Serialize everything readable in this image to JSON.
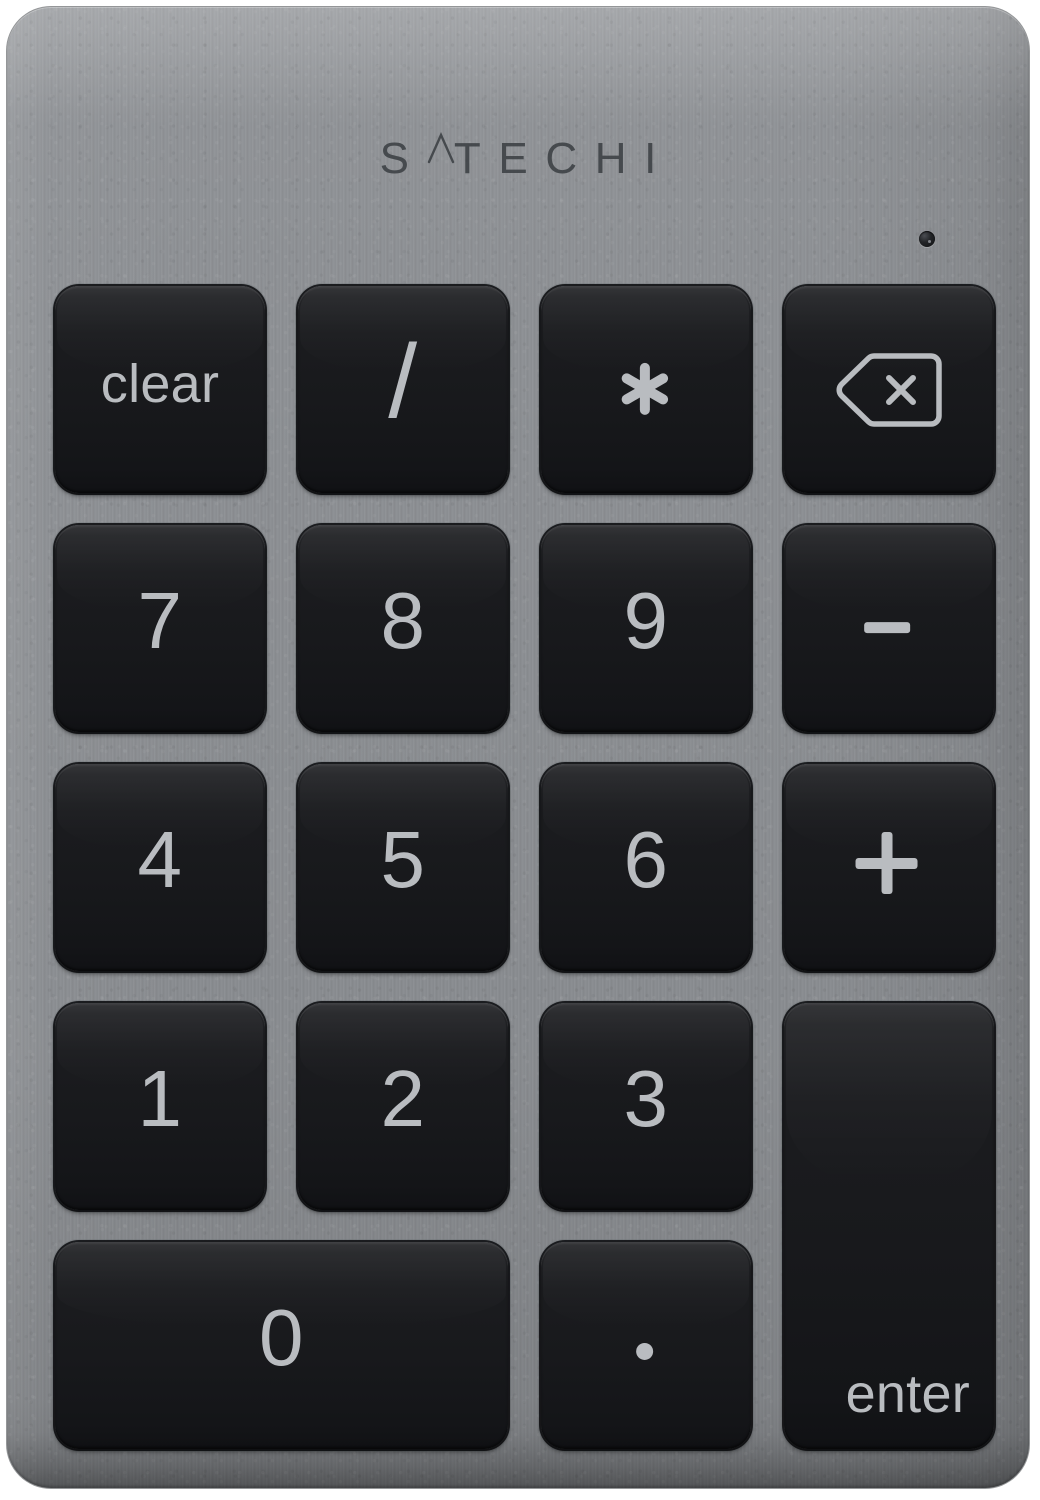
{
  "device": {
    "brand": "SATECHI",
    "brand_letters": [
      "S",
      "A",
      "T",
      "E",
      "C",
      "H",
      "I"
    ],
    "type": "wireless numeric keypad",
    "body_color": "#8d9094",
    "key_color": "#18191c",
    "legend_color": "#b9bcc0",
    "logo_color": "#3c4044"
  },
  "indicator": {
    "name": "led-indicator",
    "color": "#232528"
  },
  "keypad": {
    "columns": 4,
    "rows": 5,
    "keys": [
      {
        "id": "clear",
        "label": "clear",
        "glyph": "text",
        "row": 1,
        "col": 1,
        "rowspan": 1,
        "colspan": 1,
        "label_style": "lbl-word"
      },
      {
        "id": "divide",
        "label": "/",
        "glyph": "text",
        "row": 1,
        "col": 2,
        "rowspan": 1,
        "colspan": 1,
        "label_style": "lbl-slash"
      },
      {
        "id": "multiply",
        "label": "*",
        "glyph": "asterisk",
        "row": 1,
        "col": 3,
        "rowspan": 1,
        "colspan": 1,
        "label_style": ""
      },
      {
        "id": "delete",
        "label": "",
        "glyph": "delete",
        "row": 1,
        "col": 4,
        "rowspan": 1,
        "colspan": 1,
        "label_style": ""
      },
      {
        "id": "digit-7",
        "label": "7",
        "glyph": "text",
        "row": 2,
        "col": 1,
        "rowspan": 1,
        "colspan": 1,
        "label_style": "lbl-digit"
      },
      {
        "id": "digit-8",
        "label": "8",
        "glyph": "text",
        "row": 2,
        "col": 2,
        "rowspan": 1,
        "colspan": 1,
        "label_style": "lbl-digit"
      },
      {
        "id": "digit-9",
        "label": "9",
        "glyph": "text",
        "row": 2,
        "col": 3,
        "rowspan": 1,
        "colspan": 1,
        "label_style": "lbl-digit"
      },
      {
        "id": "minus",
        "label": "-",
        "glyph": "minus",
        "row": 2,
        "col": 4,
        "rowspan": 1,
        "colspan": 1,
        "label_style": ""
      },
      {
        "id": "digit-4",
        "label": "4",
        "glyph": "text",
        "row": 3,
        "col": 1,
        "rowspan": 1,
        "colspan": 1,
        "label_style": "lbl-digit"
      },
      {
        "id": "digit-5",
        "label": "5",
        "glyph": "text",
        "row": 3,
        "col": 2,
        "rowspan": 1,
        "colspan": 1,
        "label_style": "lbl-digit"
      },
      {
        "id": "digit-6",
        "label": "6",
        "glyph": "text",
        "row": 3,
        "col": 3,
        "rowspan": 1,
        "colspan": 1,
        "label_style": "lbl-digit"
      },
      {
        "id": "plus",
        "label": "+",
        "glyph": "plus",
        "row": 3,
        "col": 4,
        "rowspan": 1,
        "colspan": 1,
        "label_style": ""
      },
      {
        "id": "digit-1",
        "label": "1",
        "glyph": "text",
        "row": 4,
        "col": 1,
        "rowspan": 1,
        "colspan": 1,
        "label_style": "lbl-digit"
      },
      {
        "id": "digit-2",
        "label": "2",
        "glyph": "text",
        "row": 4,
        "col": 2,
        "rowspan": 1,
        "colspan": 1,
        "label_style": "lbl-digit"
      },
      {
        "id": "digit-3",
        "label": "3",
        "glyph": "text",
        "row": 4,
        "col": 3,
        "rowspan": 1,
        "colspan": 1,
        "label_style": "lbl-digit"
      },
      {
        "id": "enter",
        "label": "enter",
        "glyph": "text",
        "row": 4,
        "col": 4,
        "rowspan": 2,
        "colspan": 1,
        "label_style": "lbl-enter"
      },
      {
        "id": "digit-0",
        "label": "0",
        "glyph": "text",
        "row": 5,
        "col": 1,
        "rowspan": 1,
        "colspan": 2,
        "label_style": "lbl-digit"
      },
      {
        "id": "decimal",
        "label": ".",
        "glyph": "dot",
        "row": 5,
        "col": 3,
        "rowspan": 1,
        "colspan": 1,
        "label_style": ""
      }
    ]
  }
}
